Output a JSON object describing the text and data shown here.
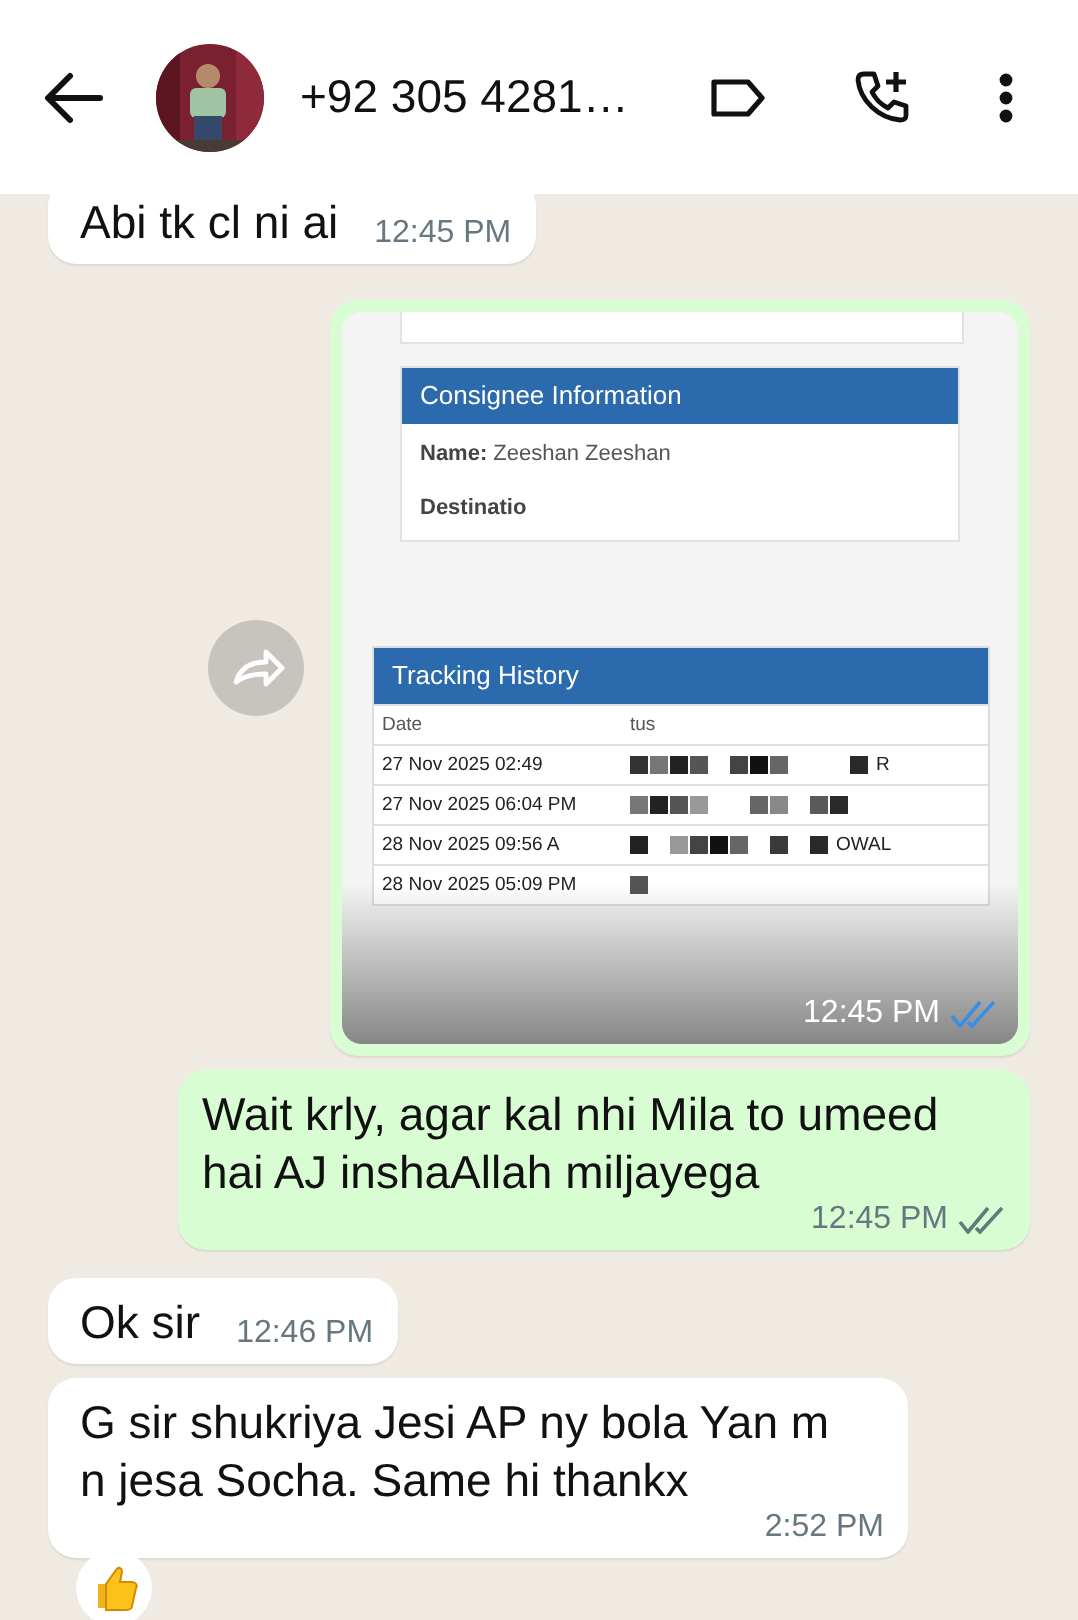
{
  "header": {
    "title": "+92 305 4281…"
  },
  "messages": [
    {
      "kind": "text",
      "outgoing": false,
      "text": "Abi tk cl ni ai",
      "time": "12:45 PM"
    },
    {
      "outgoing": true,
      "time": "12:45 PM",
      "read": true,
      "forward": true,
      "document": {
        "card": {
          "title": "Consignee Information",
          "fields": [
            {
              "label": "Name:",
              "value": "Zeeshan Zeeshan"
            },
            {
              "label": "Destinatio"
            }
          ]
        },
        "tracking": {
          "title": "Tracking History",
          "columns": [
            "Date",
            "tus"
          ],
          "rows": [
            {
              "date": "27 Nov 2025 02:49",
              "status": "R"
            },
            {
              "date": "27 Nov 2025 06:04 PM"
            },
            {
              "date": "28 Nov 2025 09:56 A",
              "status": "OWAL"
            },
            {
              "date": "28 Nov 2025 05:09 PM"
            }
          ]
        }
      }
    },
    {
      "kind": "text",
      "outgoing": true,
      "text": "Wait krly, agar kal nhi Mila to umeed hai AJ inshaAllah miljayega",
      "time": "12:45 PM",
      "read": false
    },
    {
      "kind": "text",
      "outgoing": false,
      "text": "Ok sir",
      "time": "12:46 PM"
    },
    {
      "kind": "text",
      "outgoing": false,
      "text": "G sir shukriya Jesi AP ny bola Yan m n jesa Socha. Same hi thankx",
      "time": "2:52 PM",
      "reaction": {
        "kind": "thumbs_up"
      }
    }
  ]
}
